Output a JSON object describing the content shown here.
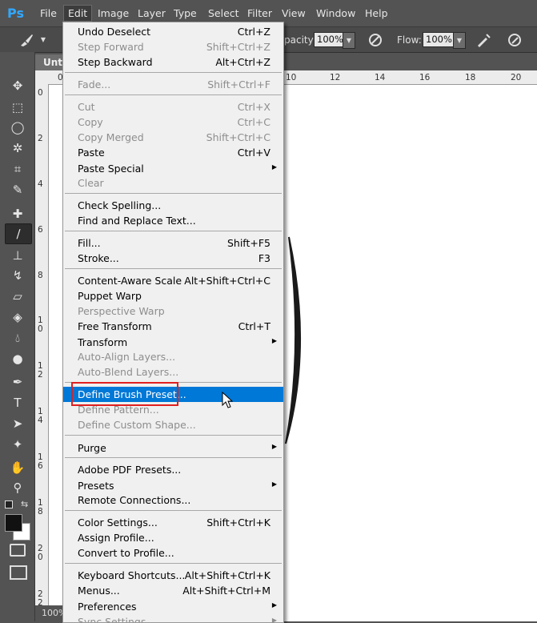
{
  "app": {
    "logo": "Ps"
  },
  "menubar": {
    "items": [
      "File",
      "Edit",
      "Image",
      "Layer",
      "Type",
      "Select",
      "Filter",
      "View",
      "Window",
      "Help"
    ],
    "active": "Edit"
  },
  "options": {
    "opacity_label": "pacity:",
    "opacity_value": "100%",
    "flow_label": "Flow:",
    "flow_value": "100%"
  },
  "document": {
    "tab_title": "Unti",
    "zoom": "100%",
    "ruler_h": [
      "0",
      "10",
      "12",
      "14",
      "16",
      "18",
      "20"
    ],
    "ruler_v": [
      "0",
      "2",
      "4",
      "6",
      "8",
      "10",
      "12",
      "14",
      "16",
      "18",
      "20",
      "22"
    ]
  },
  "edit_menu": {
    "items": [
      {
        "label": "Undo Deselect",
        "shortcut": "Ctrl+Z",
        "disabled": false
      },
      {
        "label": "Step Forward",
        "shortcut": "Shift+Ctrl+Z",
        "disabled": true
      },
      {
        "label": "Step Backward",
        "shortcut": "Alt+Ctrl+Z",
        "disabled": false
      },
      {
        "label": "Fade...",
        "shortcut": "Shift+Ctrl+F",
        "disabled": true
      },
      {
        "label": "Cut",
        "shortcut": "Ctrl+X",
        "disabled": true
      },
      {
        "label": "Copy",
        "shortcut": "Ctrl+C",
        "disabled": true
      },
      {
        "label": "Copy Merged",
        "shortcut": "Shift+Ctrl+C",
        "disabled": true
      },
      {
        "label": "Paste",
        "shortcut": "Ctrl+V",
        "disabled": false
      },
      {
        "label": "Paste Special",
        "shortcut": "",
        "disabled": false,
        "submenu": true
      },
      {
        "label": "Clear",
        "shortcut": "",
        "disabled": true
      },
      {
        "label": "Check Spelling...",
        "shortcut": "",
        "disabled": false
      },
      {
        "label": "Find and Replace Text...",
        "shortcut": "",
        "disabled": false
      },
      {
        "label": "Fill...",
        "shortcut": "Shift+F5",
        "disabled": false
      },
      {
        "label": "Stroke...",
        "shortcut": "F3",
        "disabled": false
      },
      {
        "label": "Content-Aware Scale",
        "shortcut": "Alt+Shift+Ctrl+C",
        "disabled": false
      },
      {
        "label": "Puppet Warp",
        "shortcut": "",
        "disabled": false
      },
      {
        "label": "Perspective Warp",
        "shortcut": "",
        "disabled": true
      },
      {
        "label": "Free Transform",
        "shortcut": "Ctrl+T",
        "disabled": false
      },
      {
        "label": "Transform",
        "shortcut": "",
        "disabled": false,
        "submenu": true
      },
      {
        "label": "Auto-Align Layers...",
        "shortcut": "",
        "disabled": true
      },
      {
        "label": "Auto-Blend Layers...",
        "shortcut": "",
        "disabled": true
      },
      {
        "label": "Define Brush Preset...",
        "shortcut": "",
        "disabled": false,
        "highlighted": true
      },
      {
        "label": "Define Pattern...",
        "shortcut": "",
        "disabled": true
      },
      {
        "label": "Define Custom Shape...",
        "shortcut": "",
        "disabled": true
      },
      {
        "label": "Purge",
        "shortcut": "",
        "disabled": false,
        "submenu": true
      },
      {
        "label": "Adobe PDF Presets...",
        "shortcut": "",
        "disabled": false
      },
      {
        "label": "Presets",
        "shortcut": "",
        "disabled": false,
        "submenu": true
      },
      {
        "label": "Remote Connections...",
        "shortcut": "",
        "disabled": false
      },
      {
        "label": "Color Settings...",
        "shortcut": "Shift+Ctrl+K",
        "disabled": false
      },
      {
        "label": "Assign Profile...",
        "shortcut": "",
        "disabled": false
      },
      {
        "label": "Convert to Profile...",
        "shortcut": "",
        "disabled": false
      },
      {
        "label": "Keyboard Shortcuts...",
        "shortcut": "Alt+Shift+Ctrl+K",
        "disabled": false
      },
      {
        "label": "Menus...",
        "shortcut": "Alt+Shift+Ctrl+M",
        "disabled": false
      },
      {
        "label": "Preferences",
        "shortcut": "",
        "disabled": false,
        "submenu": true
      },
      {
        "label": "Sync Settings",
        "shortcut": "",
        "disabled": true,
        "submenu": true
      }
    ]
  },
  "colors": {
    "accent": "#0078d7",
    "highlight_box": "#e02020",
    "menu_bg": "#f0f0f0",
    "app_bg": "#535353"
  },
  "toolbox": {
    "tools": [
      "move-icon",
      "marquee-icon",
      "lasso-icon",
      "magic-wand-icon",
      "crop-icon",
      "eyedropper-icon",
      "healing-brush-icon",
      "brush-icon",
      "clone-stamp-icon",
      "history-brush-icon",
      "eraser-icon",
      "paint-bucket-icon",
      "blur-icon",
      "dodge-icon",
      "pen-icon",
      "type-icon",
      "path-selection-icon",
      "shape-icon",
      "hand-icon",
      "zoom-icon"
    ]
  }
}
